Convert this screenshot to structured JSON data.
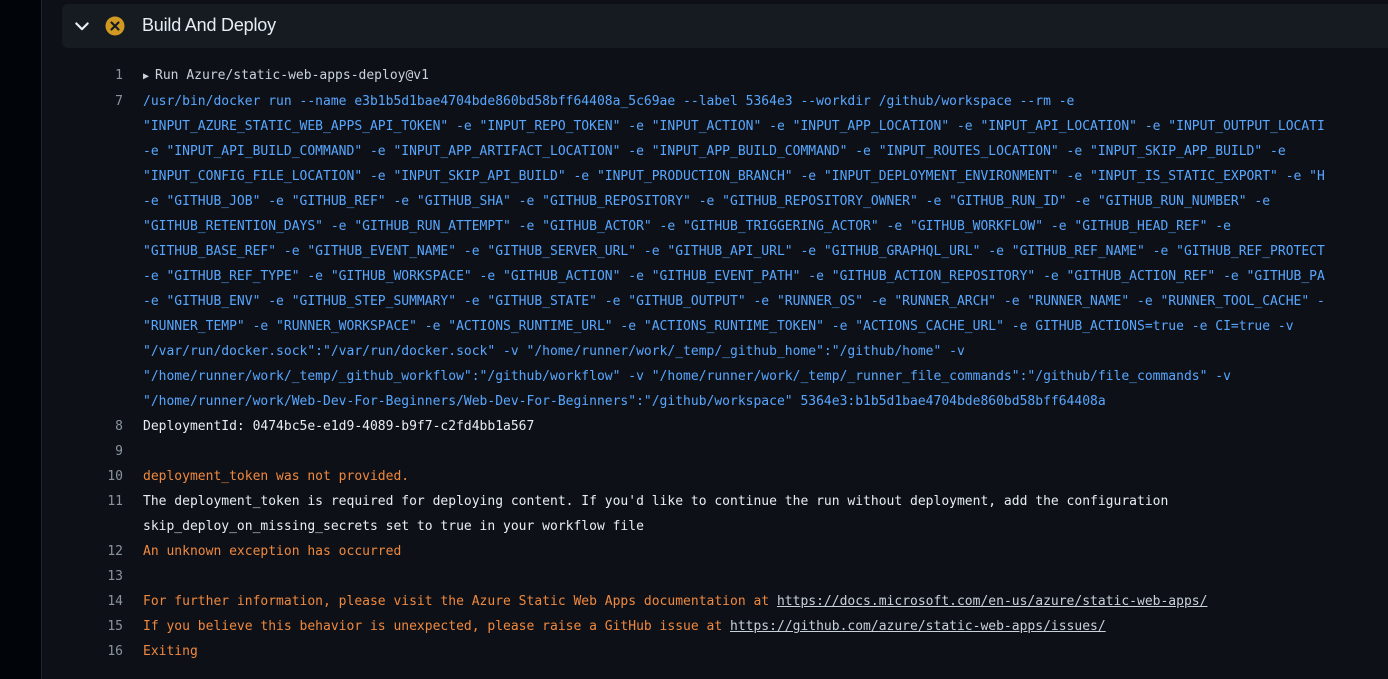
{
  "step": {
    "title": "Build And Deploy",
    "status": "failed",
    "status_color": "#d29922"
  },
  "colors": {
    "command": "#58a6ff",
    "warning": "#f0883e",
    "text": "#e6edf3",
    "line_number": "#8b949e"
  },
  "log": {
    "line1": {
      "number": "1",
      "toggle_icon": "triangle-right-icon",
      "text": "Run Azure/static-web-apps-deploy@v1"
    },
    "line7": {
      "number": "7",
      "wrapped": [
        "/usr/bin/docker run --name e3b1b5d1bae4704bde860bd58bff64408a_5c69ae --label 5364e3 --workdir /github/workspace --rm -e",
        "\"INPUT_AZURE_STATIC_WEB_APPS_API_TOKEN\" -e \"INPUT_REPO_TOKEN\" -e \"INPUT_ACTION\" -e \"INPUT_APP_LOCATION\" -e \"INPUT_API_LOCATION\" -e \"INPUT_OUTPUT_LOCATI",
        "-e \"INPUT_API_BUILD_COMMAND\" -e \"INPUT_APP_ARTIFACT_LOCATION\" -e \"INPUT_APP_BUILD_COMMAND\" -e \"INPUT_ROUTES_LOCATION\" -e \"INPUT_SKIP_APP_BUILD\" -e",
        "\"INPUT_CONFIG_FILE_LOCATION\" -e \"INPUT_SKIP_API_BUILD\" -e \"INPUT_PRODUCTION_BRANCH\" -e \"INPUT_DEPLOYMENT_ENVIRONMENT\" -e \"INPUT_IS_STATIC_EXPORT\" -e \"H",
        "-e \"GITHUB_JOB\" -e \"GITHUB_REF\" -e \"GITHUB_SHA\" -e \"GITHUB_REPOSITORY\" -e \"GITHUB_REPOSITORY_OWNER\" -e \"GITHUB_RUN_ID\" -e \"GITHUB_RUN_NUMBER\" -e",
        "\"GITHUB_RETENTION_DAYS\" -e \"GITHUB_RUN_ATTEMPT\" -e \"GITHUB_ACTOR\" -e \"GITHUB_TRIGGERING_ACTOR\" -e \"GITHUB_WORKFLOW\" -e \"GITHUB_HEAD_REF\" -e",
        "\"GITHUB_BASE_REF\" -e \"GITHUB_EVENT_NAME\" -e \"GITHUB_SERVER_URL\" -e \"GITHUB_API_URL\" -e \"GITHUB_GRAPHQL_URL\" -e \"GITHUB_REF_NAME\" -e \"GITHUB_REF_PROTECT",
        "-e \"GITHUB_REF_TYPE\" -e \"GITHUB_WORKSPACE\" -e \"GITHUB_ACTION\" -e \"GITHUB_EVENT_PATH\" -e \"GITHUB_ACTION_REPOSITORY\" -e \"GITHUB_ACTION_REF\" -e \"GITHUB_PA",
        "-e \"GITHUB_ENV\" -e \"GITHUB_STEP_SUMMARY\" -e \"GITHUB_STATE\" -e \"GITHUB_OUTPUT\" -e \"RUNNER_OS\" -e \"RUNNER_ARCH\" -e \"RUNNER_NAME\" -e \"RUNNER_TOOL_CACHE\" -",
        "\"RUNNER_TEMP\" -e \"RUNNER_WORKSPACE\" -e \"ACTIONS_RUNTIME_URL\" -e \"ACTIONS_RUNTIME_TOKEN\" -e \"ACTIONS_CACHE_URL\" -e GITHUB_ACTIONS=true -e CI=true -v",
        "\"/var/run/docker.sock\":\"/var/run/docker.sock\" -v \"/home/runner/work/_temp/_github_home\":\"/github/home\" -v",
        "\"/home/runner/work/_temp/_github_workflow\":\"/github/workflow\" -v \"/home/runner/work/_temp/_runner_file_commands\":\"/github/file_commands\" -v",
        "\"/home/runner/work/Web-Dev-For-Beginners/Web-Dev-For-Beginners\":\"/github/workspace\" 5364e3:b1b5d1bae4704bde860bd58bff64408a"
      ]
    },
    "line8": {
      "number": "8",
      "text": "DeploymentId: 0474bc5e-e1d9-4089-b9f7-c2fd4bb1a567"
    },
    "line9": {
      "number": "9",
      "text": ""
    },
    "line10": {
      "number": "10",
      "text": "deployment_token was not provided."
    },
    "line11": {
      "number": "11",
      "wrapped": [
        "The deployment_token is required for deploying content. If you'd like to continue the run without deployment, add the configuration",
        "skip_deploy_on_missing_secrets set to true in your workflow file"
      ]
    },
    "line12": {
      "number": "12",
      "text": "An unknown exception has occurred"
    },
    "line13": {
      "number": "13",
      "text": ""
    },
    "line14": {
      "number": "14",
      "text": "For further information, please visit the Azure Static Web Apps documentation at ",
      "link": "https://docs.microsoft.com/en-us/azure/static-web-apps/"
    },
    "line15": {
      "number": "15",
      "text": "If you believe this behavior is unexpected, please raise a GitHub issue at ",
      "link": "https://github.com/azure/static-web-apps/issues/"
    },
    "line16": {
      "number": "16",
      "text": "Exiting"
    }
  }
}
